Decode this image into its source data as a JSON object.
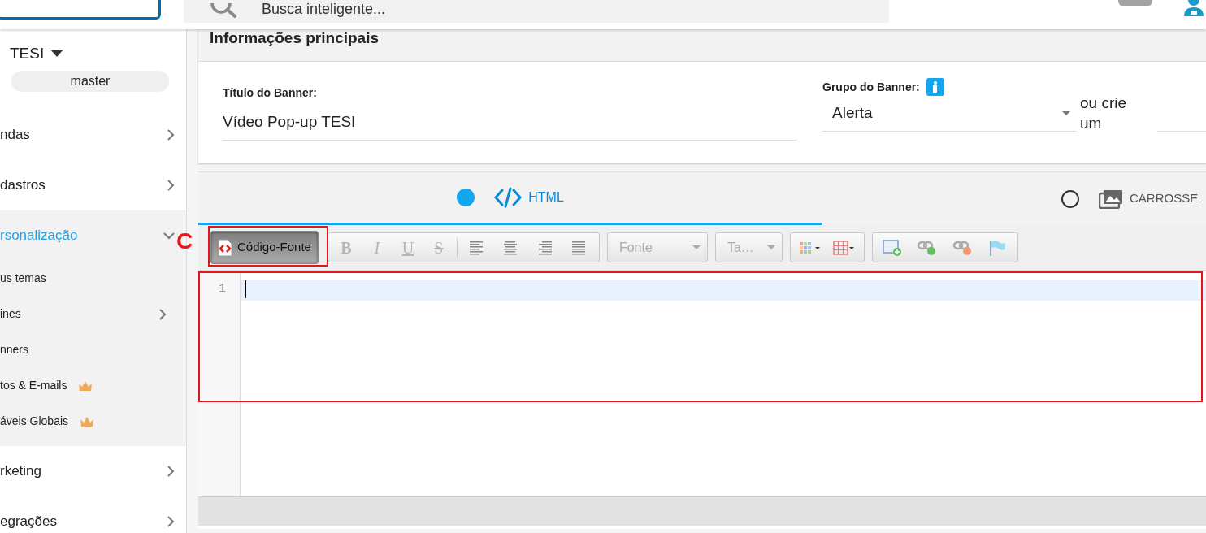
{
  "header": {
    "search": {
      "placeholder": "Busca inteligente..."
    },
    "toggle": {
      "on": false
    }
  },
  "sidebar": {
    "store": "TESI",
    "branch": "master",
    "items": [
      {
        "label": "ndas",
        "selected": false,
        "expanded": false
      },
      {
        "label": "dastros",
        "selected": false,
        "expanded": false
      },
      {
        "label": "rsonalização",
        "selected": true,
        "expanded": true,
        "children": [
          {
            "label": "us temas",
            "kind": "link",
            "premium": false
          },
          {
            "label": "ines",
            "kind": "group",
            "premium": false
          },
          {
            "label": "nners",
            "kind": "link",
            "premium": false
          },
          {
            "label": "tos & E-mails",
            "kind": "link",
            "premium": true
          },
          {
            "label": "áveis Globais",
            "kind": "link",
            "premium": true
          }
        ]
      },
      {
        "label": "rketing",
        "selected": false,
        "expanded": false
      },
      {
        "label": "egrações",
        "selected": false,
        "expanded": false
      }
    ]
  },
  "main_info": {
    "title": "Informações principais",
    "banner_title": {
      "label": "Título do Banner:",
      "value": "Vídeo Pop-up TESI"
    },
    "banner_group": {
      "label": "Grupo do Banner:",
      "value": "Alerta",
      "alternative": "ou crie um"
    }
  },
  "tabs": [
    {
      "label": "HTML",
      "selected": true
    },
    {
      "label": "CARROSSE",
      "selected": false
    }
  ],
  "toolbar": {
    "source_button": {
      "label": "Código-Fonte",
      "pressed": true
    },
    "format_buttons": [
      {
        "label": "B",
        "disabled": true
      },
      {
        "label": "I",
        "disabled": true
      },
      {
        "label": "U",
        "disabled": true
      },
      {
        "label": "S",
        "disabled": true
      }
    ],
    "font_select": {
      "placeholder": "Fonte"
    },
    "size_select": {
      "placeholder": "Ta…"
    }
  },
  "editor": {
    "lines": [
      {
        "number": "1",
        "active": true
      }
    ]
  },
  "annotation": {
    "label": "C"
  }
}
